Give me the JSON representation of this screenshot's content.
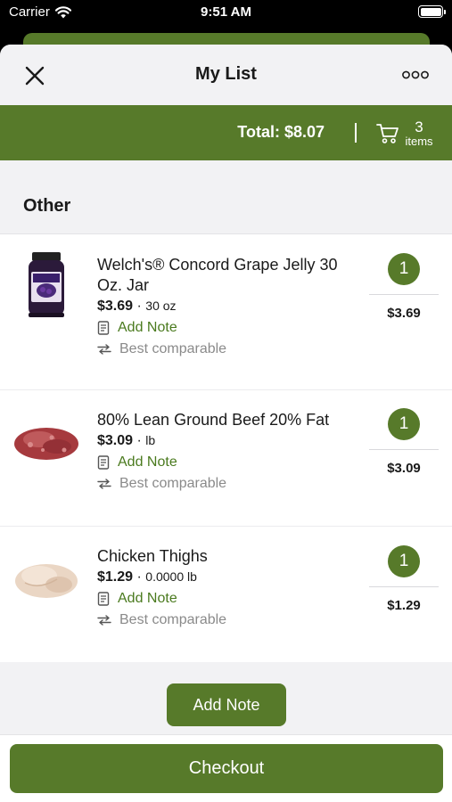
{
  "status_bar": {
    "carrier": "Carrier",
    "time": "9:51 AM"
  },
  "nav": {
    "title": "My List",
    "close_icon": "close-icon",
    "more_icon": "more-icon"
  },
  "summary": {
    "total": "Total: $8.07",
    "item_count": "3",
    "item_count_label": "items",
    "cart_icon": "cart-icon"
  },
  "section": {
    "title": "Other"
  },
  "items": [
    {
      "name": "Welch's® Concord Grape Jelly 30 Oz. Jar",
      "price": "$3.69",
      "separator": "·",
      "unit": "30 oz",
      "note_label": "Add Note",
      "comparable_label": "Best comparable",
      "quantity": "1",
      "line_total": "$3.69",
      "image": "grape-jelly-jar"
    },
    {
      "name": "80% Lean Ground Beef 20% Fat",
      "price": "$3.09",
      "separator": "·",
      "unit": "lb",
      "note_label": "Add Note",
      "comparable_label": "Best comparable",
      "quantity": "1",
      "line_total": "$3.09",
      "image": "ground-beef"
    },
    {
      "name": "Chicken Thighs",
      "price": "$1.29",
      "separator": "·",
      "unit": "0.0000 lb",
      "note_label": "Add Note",
      "comparable_label": "Best comparable",
      "quantity": "1",
      "line_total": "$1.29",
      "image": "chicken-thighs"
    }
  ],
  "actions": {
    "add_note": "Add Note",
    "checkout": "Checkout"
  },
  "colors": {
    "accent": "#577a2a",
    "note_text": "#4a7a1e",
    "muted_text": "#8a8a8a",
    "background": "#f2f2f4"
  }
}
